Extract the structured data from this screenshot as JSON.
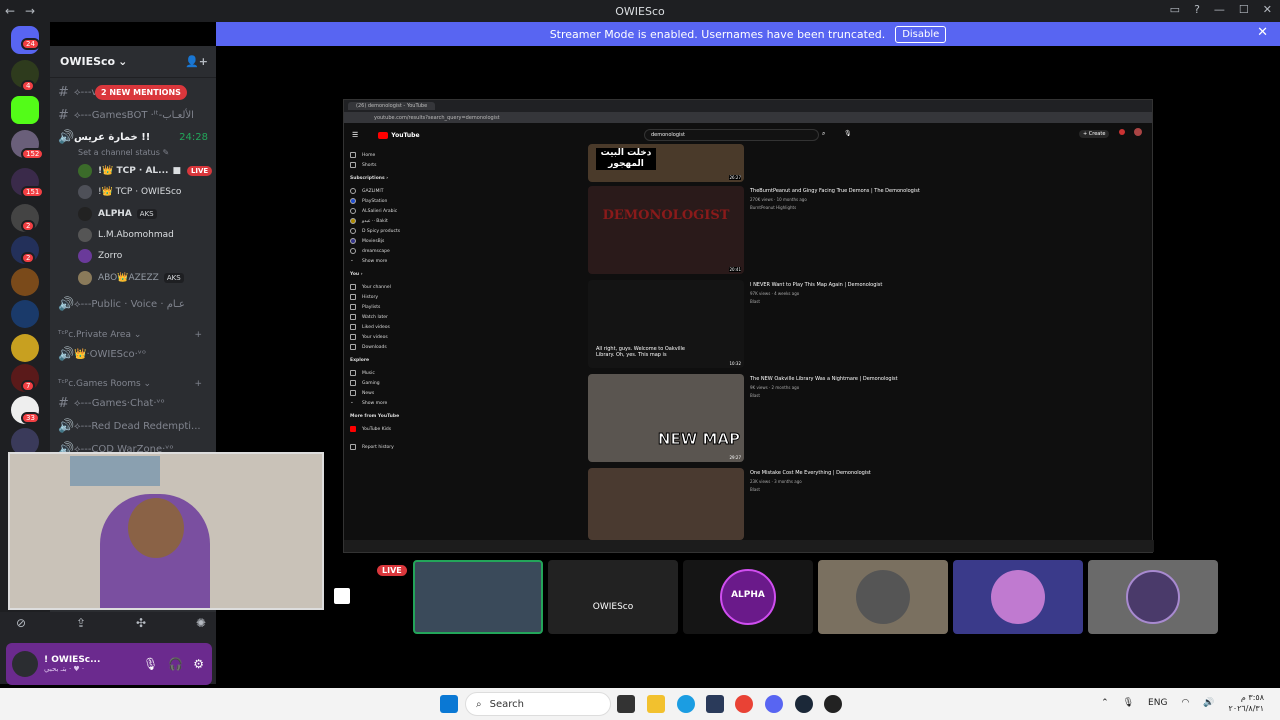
{
  "window": {
    "title": "OWIESco",
    "back": "←",
    "forward": "→"
  },
  "banner": {
    "text": "Streamer Mode is enabled. Usernames have been truncated.",
    "button": "Disable",
    "close": "✕"
  },
  "guild_badges": [
    "24",
    "4",
    "152",
    "151",
    "2",
    "2",
    "7",
    "33"
  ],
  "server": {
    "name": "OWIESco",
    "chevron": "⌄"
  },
  "mentions_pill": "2 NEW MENTIONS",
  "channels": [
    {
      "icon": "#",
      "name": "⟡---ᴠɪᴄ-الـكــلام"
    },
    {
      "icon": "#",
      "name": "⟡---GamesBOT ·ᴵᵗ-الألعـاب"
    }
  ],
  "voice_channel": {
    "name": "خمارة عريس !!",
    "timer": "24:28",
    "status": "Set a channel status ✎"
  },
  "voice_users": [
    {
      "name": "!👑 TCP · AL...",
      "live": "LIVE"
    },
    {
      "name": "!👑 TCP · OWIESco"
    },
    {
      "name": "ALPHA",
      "tag": "AKS"
    },
    {
      "name": "L.M.Abomohmad"
    },
    {
      "name": "Zorro"
    },
    {
      "name": "ABO👑AZEZZ",
      "tag": "AKS"
    }
  ],
  "more_channels": [
    {
      "name": "⟡---Public · Voice · عـام"
    }
  ],
  "categories": [
    {
      "name": "ᵀᶜᴾc.Private Area ⌄",
      "channels": [
        "👑·OWIESco·ᵛᵒ"
      ]
    },
    {
      "name": "ᵀᶜᴾc.Games Rooms ⌄",
      "channels": [
        "⟡---Games·Chat·ᵛᵒ",
        "⟡---Red Dead Redempti...",
        "⟡---COD WarZone·ᵛᵒ"
      ]
    }
  ],
  "user": {
    "name": "! OWIESc...",
    "status": "بتـ بحبي · ♥ ·"
  },
  "browser": {
    "tab": "(26) demonologist - YouTube",
    "url": "youtube.com/results?search_query=demonologist",
    "search": "demonologist",
    "create": "+ Create",
    "sidebar": {
      "main": [
        "Home",
        "Shorts"
      ],
      "subs_title": "Subscriptions ›",
      "subs": [
        "GAZLIMIT",
        "PlayStation",
        "ALSalieri Arabic",
        "عبدو ·· Bakit",
        "D Spicy products",
        "MoviesBjs",
        "dreamscape"
      ],
      "subs_more": "Show more",
      "you_title": "You ›",
      "you": [
        "Your channel",
        "History",
        "Playlists",
        "Watch later",
        "Liked videos",
        "Your videos",
        "Downloads"
      ],
      "explore_title": "Explore",
      "explore": [
        "Music",
        "Gaming",
        "News",
        "Show more"
      ],
      "more_title": "More from YouTube",
      "more": [
        "YouTube Kids"
      ],
      "report": "Report history"
    },
    "results": [
      {
        "title": "TheBurntPeanut and Gingy Facing True Demons | The Demonologist",
        "meta": "270K views · 10 months ago",
        "channel": "BurntPeanut Highlights",
        "thumb": "DEMONOLOGIST",
        "dur": "20:41"
      },
      {
        "title": "I NEVER Want to Play This Map Again | Demonologist",
        "meta": "97K views · 4 weeks ago",
        "channel": "Blast",
        "caption": "All right, guys. Welcome to Oakville Library. Oh, yes. This map is",
        "dur": "10:32"
      },
      {
        "title": "The NEW Oakville Library Was a Nightmare | Demonologist",
        "meta": "9K views · 2 months ago",
        "channel": "Blast",
        "thumb": "NEW MAP",
        "dur": "29:27"
      },
      {
        "title": "One Mistake Cost Me Everything | Demonologist",
        "meta": "23K views · 3 months ago",
        "channel": "Blast"
      }
    ],
    "top_thumb_text": "دخلت البيت المهجور",
    "top_dur": "26:27"
  },
  "stream_tiles": {
    "live": "LIVE",
    "owiesco_label": "OWIESco",
    "alpha_label": "ALPHA"
  },
  "taskbar": {
    "search": "Search",
    "lang": "ENG",
    "time": "٣:٥٨ م",
    "date": "٢٠٢٦/٨/٣١"
  },
  "colors": {
    "blurple": "#5865f2",
    "live_red": "#da373c",
    "userbar": "#6b2a8e"
  }
}
